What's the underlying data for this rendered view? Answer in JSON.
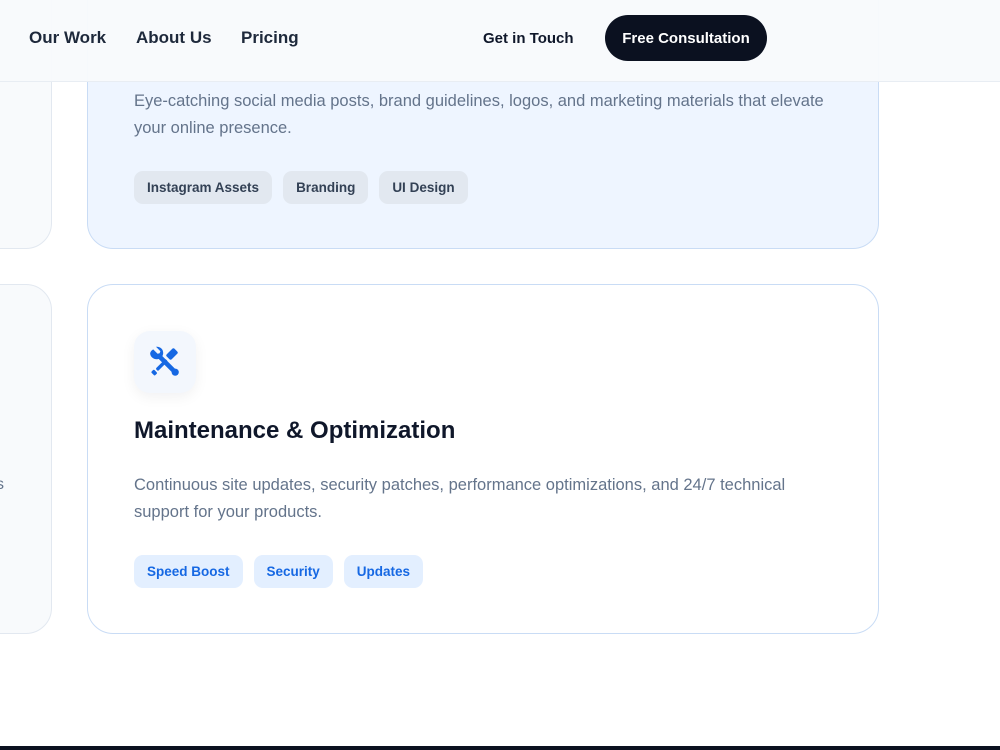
{
  "header": {
    "nav": [
      {
        "label": "Our Work"
      },
      {
        "label": "About Us"
      },
      {
        "label": "Pricing"
      }
    ],
    "get_in_touch": "Get in Touch",
    "cta": "Free Consultation"
  },
  "design_card": {
    "description": "Eye-catching social media posts, brand guidelines, logos, and marketing materials that elevate your online presence.",
    "tags": [
      "Instagram Assets",
      "Branding",
      "UI Design"
    ]
  },
  "maintenance_card": {
    "icon": "wrench-screwdriver-icon",
    "title": "Maintenance & Optimization",
    "description": "Continuous site updates, security patches, performance optimizations, and 24/7 technical support for your products.",
    "tags": [
      "Speed Boost",
      "Security",
      "Updates"
    ]
  },
  "left_card": {
    "partial_text": "s"
  },
  "colors": {
    "accent": "#1668e3",
    "cta_bg": "#0b1120",
    "design_card_bg": "#eef5ff"
  }
}
